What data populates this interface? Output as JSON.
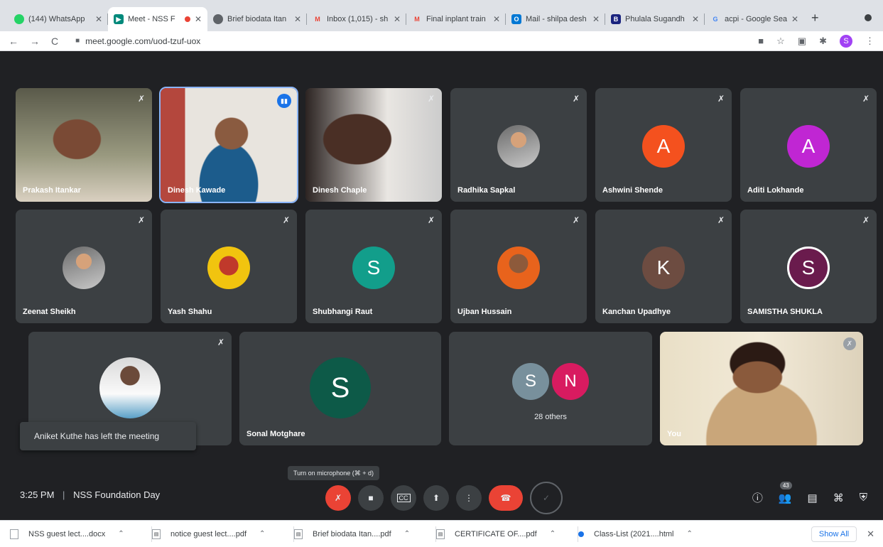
{
  "browser": {
    "tabs": [
      {
        "title": "(144) WhatsApp",
        "favicon": "whatsapp-icon",
        "color": "#25d366"
      },
      {
        "title": "Meet - NSS F",
        "favicon": "meet-icon",
        "color": "#00897b",
        "active": true,
        "recording": true
      },
      {
        "title": "Brief biodata Itan",
        "favicon": "chrome-icon",
        "color": "#5f6368"
      },
      {
        "title": "Inbox (1,015) - sh",
        "favicon": "gmail-icon",
        "color": "#ea4335"
      },
      {
        "title": "Final inplant train",
        "favicon": "gmail-icon",
        "color": "#ea4335"
      },
      {
        "title": "Mail - shilpa desh",
        "favicon": "outlook-icon",
        "color": "#0078d4"
      },
      {
        "title": "Phulala Sugandh",
        "favicon": "blog-icon",
        "color": "#1a237e"
      },
      {
        "title": "acpi - Google Sea",
        "favicon": "google-icon",
        "color": "#4285f4"
      }
    ],
    "url": "meet.google.com/uod-tzuf-uox",
    "profile_initial": "S"
  },
  "participants": [
    {
      "name": "Prakash Itankar",
      "type": "video"
    },
    {
      "name": "Dinesh Kawade",
      "type": "video",
      "speaking": true
    },
    {
      "name": "Dinesh Chaple",
      "type": "video"
    },
    {
      "name": "Radhika Sapkal",
      "type": "photo"
    },
    {
      "name": "Ashwini Shende",
      "type": "initial",
      "initial": "A",
      "color": "#f4511e"
    },
    {
      "name": "Aditi Lokhande",
      "type": "initial",
      "initial": "A",
      "color": "#c026d3"
    },
    {
      "name": "Zeenat Sheikh",
      "type": "photo"
    },
    {
      "name": "Yash Shahu",
      "type": "photo"
    },
    {
      "name": "Shubhangi Raut",
      "type": "initial",
      "initial": "S",
      "color": "#129e8b"
    },
    {
      "name": "Ujban Hussain",
      "type": "photo"
    },
    {
      "name": "Kanchan Upadhye",
      "type": "initial",
      "initial": "K",
      "color": "#6d4c41"
    },
    {
      "name": "SAMISTHA SHUKLA",
      "type": "initial",
      "initial": "S",
      "color": "#6a1b4d"
    },
    {
      "name": "",
      "type": "photo"
    },
    {
      "name": "Sonal Motghare",
      "type": "initial",
      "initial": "S",
      "color": "#0d5a48"
    }
  ],
  "others": {
    "avatars": [
      {
        "initial": "S",
        "color": "#78909c"
      },
      {
        "initial": "N",
        "color": "#d81b60"
      }
    ],
    "label": "28 others"
  },
  "self": {
    "name": "You"
  },
  "toast": "Aniket Kuthe has left the meeting",
  "tooltip": "Turn on microphone (⌘ + d)",
  "meeting": {
    "time": "3:25 PM",
    "title": "NSS Foundation Day",
    "people_count": "43"
  },
  "downloads": [
    "NSS guest lect....docx",
    "notice guest lect....pdf",
    "Brief biodata Itan....pdf",
    "CERTIFICATE OF....pdf",
    "Class-List (2021....html"
  ],
  "show_all": "Show All"
}
